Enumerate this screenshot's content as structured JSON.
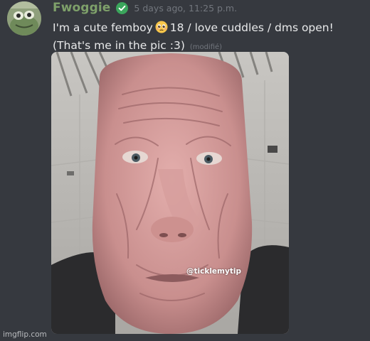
{
  "message": {
    "author": "Fwoggie",
    "timestamp": "5 days ago, 11:25 p.m.",
    "text_before_emoji": "I'm a cute femboy",
    "emoji": "pleading-face-emoji",
    "text_after_emoji": "18 / love cuddles / dms open! (That's me in the pic :3)",
    "edited_label": "(modifié)"
  },
  "attachment": {
    "watermark": "@ticklemytip"
  },
  "site_watermark": "imgflip.com",
  "colors": {
    "background": "#36393f",
    "username": "#7ea06a",
    "verified": "#3ba55c",
    "timestamp": "#72767d",
    "text": "#e8e9ea"
  },
  "icons": {
    "avatar": "frog-avatar",
    "verified": "verified-check-icon"
  }
}
